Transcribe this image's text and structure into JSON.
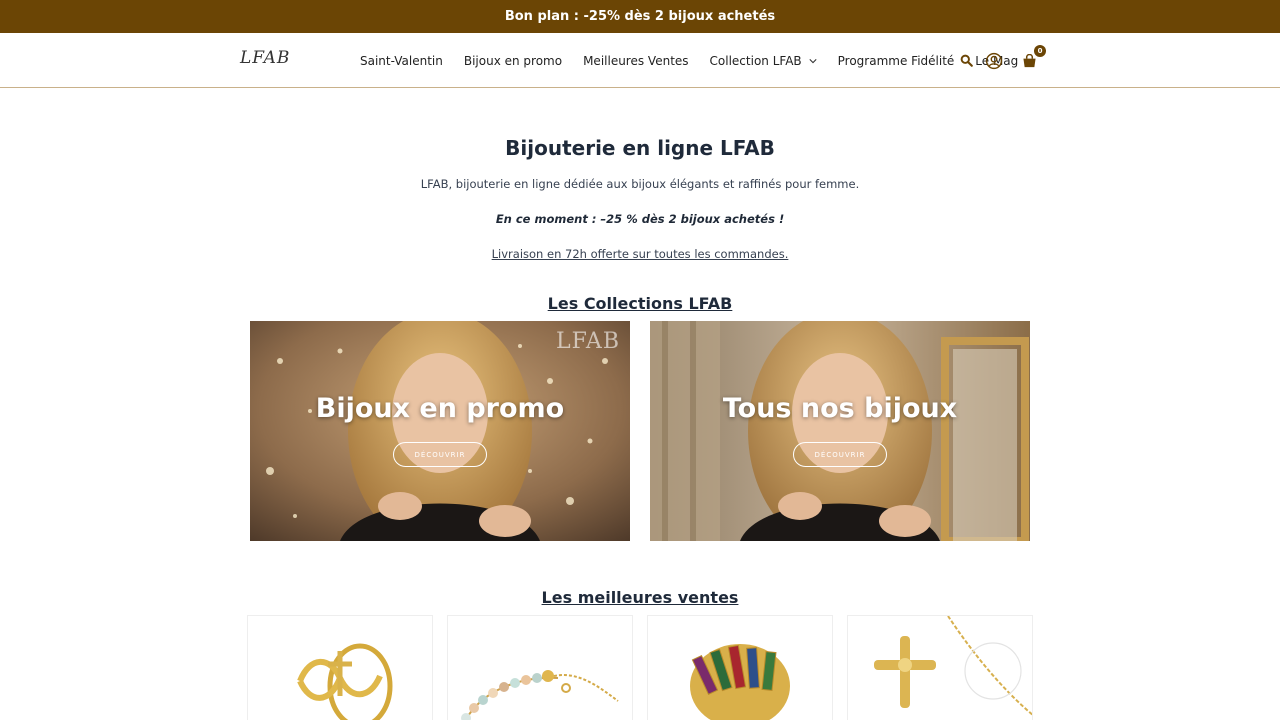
{
  "promo_bar": {
    "text": "Bon plan : -25% dès 2 bijoux achetés"
  },
  "header": {
    "logo": "LFAB",
    "nav": [
      {
        "label": "Saint-Valentin"
      },
      {
        "label": "Bijoux en promo"
      },
      {
        "label": "Meilleures Ventes"
      },
      {
        "label": "Collection LFAB",
        "dropdown": true
      },
      {
        "label": "Programme Fidélité"
      },
      {
        "label": "Le Mag"
      }
    ],
    "icons": [
      "search-icon",
      "account-icon",
      "cart-icon"
    ],
    "cart_count": "0"
  },
  "hero": {
    "title": "Bijouterie en ligne LFAB",
    "intro": "LFAB, bijouterie en ligne dédiée aux bijoux élégants et raffinés pour femme.",
    "moment": "En ce moment : –25 % dès 2 bijoux achetés !",
    "livraison": "Livraison en 72h offerte sur toutes les commandes."
  },
  "collections": {
    "title": "Les Collections LFAB",
    "cards": [
      {
        "label": "Bijoux en promo",
        "button": "DÉCOUVRIR",
        "watermark": "LFAB"
      },
      {
        "label": "Tous nos bijoux",
        "button": "DÉCOUVRIR"
      }
    ]
  },
  "best_sellers": {
    "title": "Les meilleures ventes",
    "products": [
      "ring-infinity-cross",
      "bracelet-beads",
      "ring-multicolor",
      "necklace-cross"
    ]
  },
  "colors": {
    "brand": "#6b4505",
    "text": "#1f2a3a",
    "border": "#c9b18a"
  }
}
